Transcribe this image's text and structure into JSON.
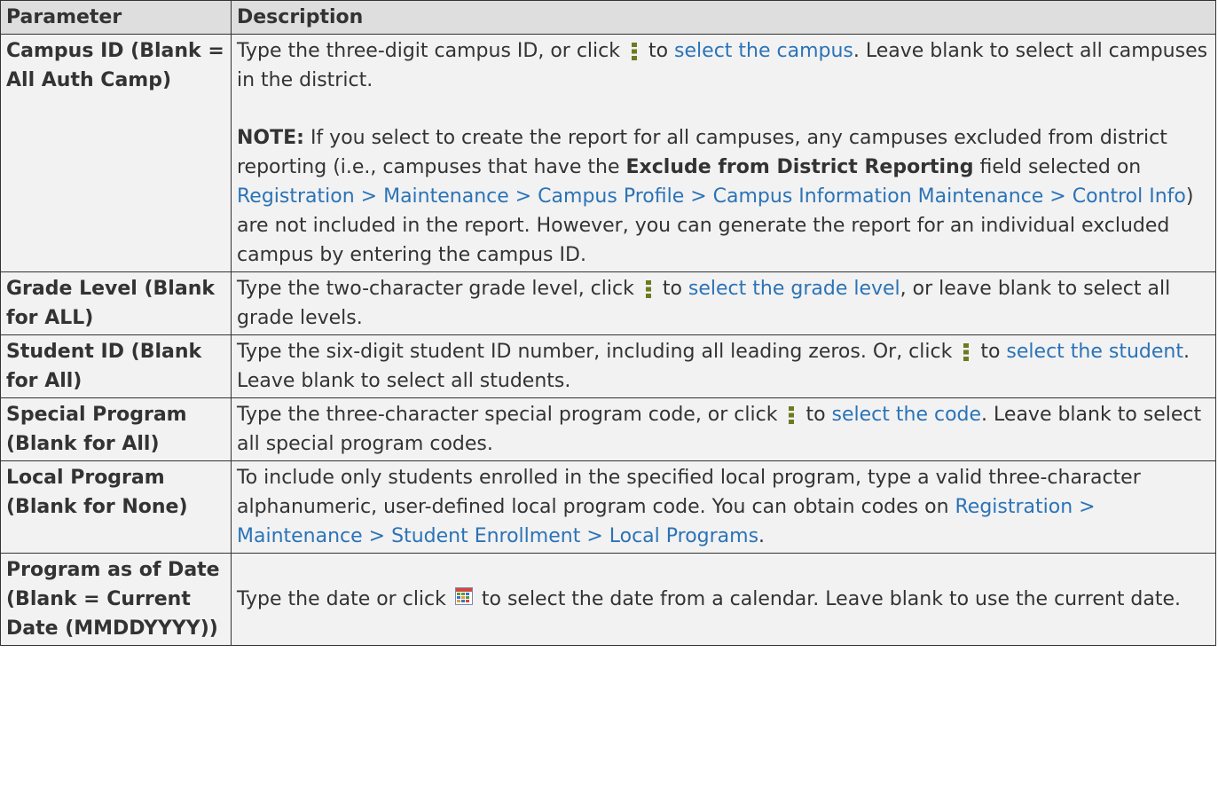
{
  "header": {
    "col1": "Parameter",
    "col2": "Description"
  },
  "rows": [
    {
      "name": "Campus ID (Blank = All Auth Camp)",
      "desc": {
        "t1": "Type the three-digit campus ID, or click ",
        "icon": "kebab-lookup-icon",
        "link1": "select the campus",
        "t2": ". Leave blank to select all campuses in the district.",
        "note_label": "NOTE:",
        "note_t1": " If you select to create the report for all campuses, any campuses excluded from district reporting (i.e., campuses that have the ",
        "note_bold": "Exclude from District Reporting",
        "note_t2": " field selected on ",
        "note_link": "Registration > Maintenance > Campus Profile > Campus Information Maintenance > Control Info",
        "note_t3": ") are not included in the report. However, you can generate the report for an individual excluded campus by entering the campus ID."
      }
    },
    {
      "name": "Grade Level (Blank for ALL)",
      "desc": {
        "t1": "Type the two-character grade level, click ",
        "t_to": " to ",
        "link1": "select the grade level",
        "t2": ", or leave blank to select all grade levels."
      }
    },
    {
      "name": "Student ID (Blank for All)",
      "desc": {
        "t1": "Type the six-digit student ID number, including all leading zeros. Or, click ",
        "t_to": " to ",
        "link1": "select the student",
        "t2": ". Leave blank to select all students."
      }
    },
    {
      "name": "Special Program (Blank for All)",
      "desc": {
        "t1": "Type the three-character special program code, or click ",
        "t_to": " to ",
        "link1": "select the code",
        "t2": ". Leave blank to select all special program codes."
      }
    },
    {
      "name": "Local Program (Blank for None)",
      "desc": {
        "t1": "To include only students enrolled in the specified local program, type a valid three-character alphanumeric, user-defined local program code. You can obtain codes on ",
        "link1": "Registration > Maintenance > Student Enrollment > Local Programs",
        "t2": "."
      }
    },
    {
      "name": "Program as of Date (Blank = Current Date (MMDDYYYY))",
      "desc": {
        "t1": "Type the date or click ",
        "icon": "calendar-icon",
        "t2": " to select the date from a calendar. Leave blank to use the current date."
      }
    }
  ],
  "colors": {
    "link": "#2b73b7",
    "cell_bg": "#f2f2f2",
    "header_bg": "#dedede",
    "border": "#333333"
  }
}
